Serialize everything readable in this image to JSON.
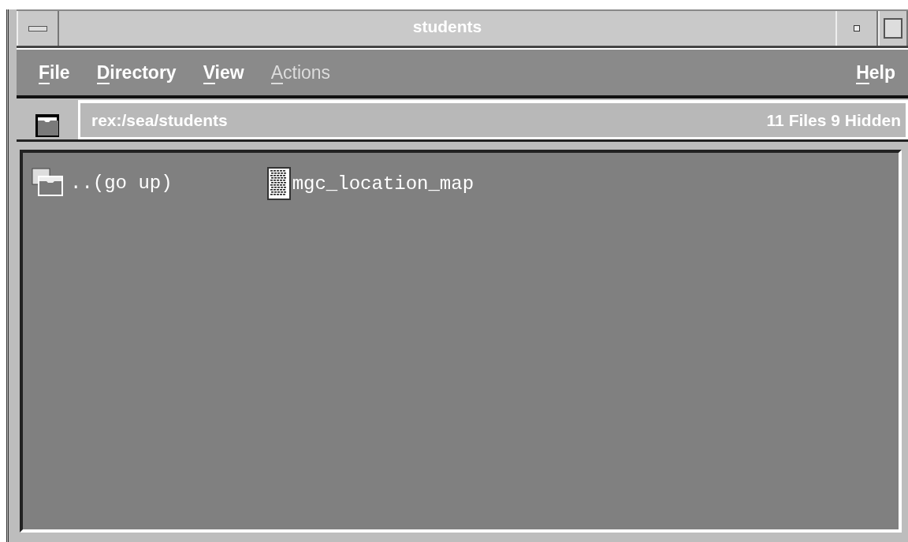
{
  "window": {
    "title": "students"
  },
  "menu": [
    {
      "label": "File",
      "disabled": false
    },
    {
      "label": "Directory",
      "disabled": false
    },
    {
      "label": "View",
      "disabled": false
    },
    {
      "label": "Actions",
      "disabled": true
    }
  ],
  "help_menu": {
    "label": "Help",
    "disabled": false
  },
  "path_bar": {
    "path": "rex:/sea/students",
    "summary": "11 Files 9 Hidden"
  },
  "files": [
    {
      "kind": "up",
      "name": "..(go up)"
    },
    {
      "kind": "file",
      "name": "mgc_location_map"
    }
  ]
}
